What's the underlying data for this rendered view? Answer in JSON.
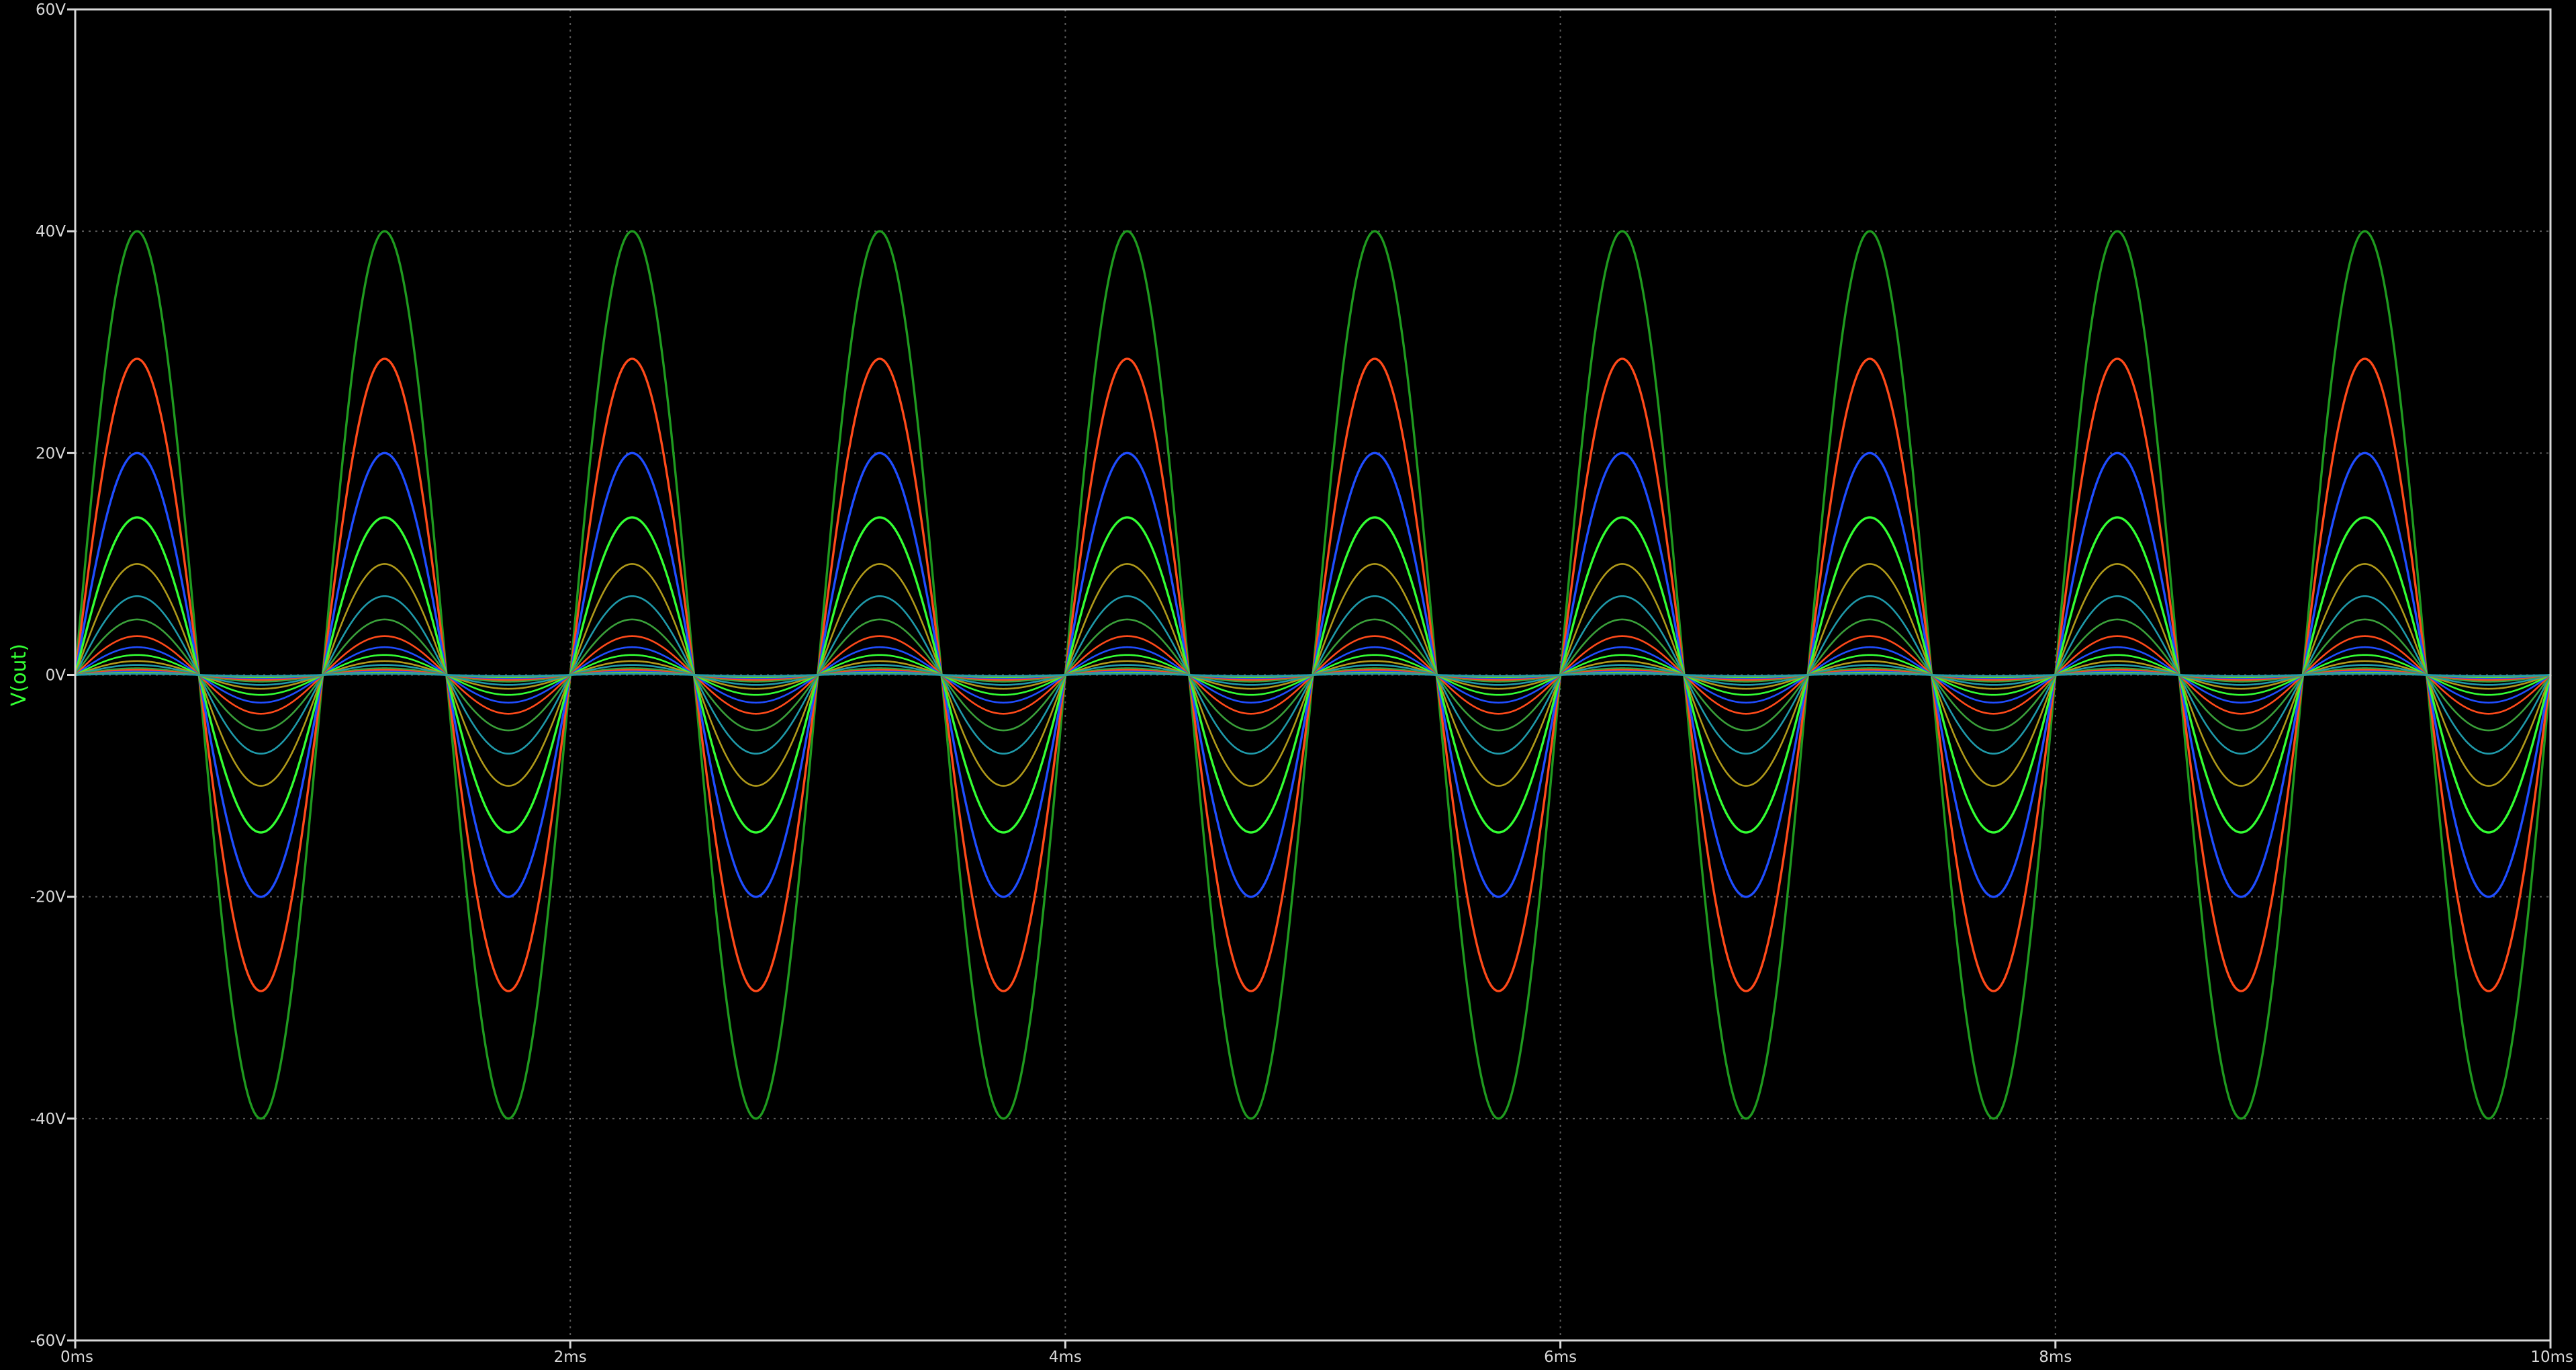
{
  "chart_data": {
    "type": "line",
    "title": "",
    "xlabel": "",
    "ylabel": "V(out)",
    "xlim": [
      0,
      10
    ],
    "ylim": [
      -60,
      60
    ],
    "x_unit": "ms",
    "y_unit": "V",
    "x_ticks": [
      "0ms",
      "2ms",
      "4ms",
      "6ms",
      "8ms",
      "10ms"
    ],
    "x_tick_values": [
      0,
      2,
      4,
      6,
      8,
      10
    ],
    "y_ticks": [
      "60V",
      "40V",
      "20V",
      "0V",
      "-20V",
      "-40V",
      "-60V"
    ],
    "y_tick_values": [
      60,
      40,
      20,
      0,
      -20,
      -40,
      -60
    ],
    "grid": true,
    "legend": "none",
    "waveform": "sine",
    "frequency_hz": 1000,
    "series": [
      {
        "amplitude": 40,
        "color": "#1f9a1f"
      },
      {
        "amplitude": 28.5,
        "color": "#ff4a1a"
      },
      {
        "amplitude": 20,
        "color": "#1f4dff"
      },
      {
        "amplitude": 14.2,
        "color": "#33ff33"
      },
      {
        "amplitude": 10,
        "color": "#b09a1a"
      },
      {
        "amplitude": 7.1,
        "color": "#1f9aaa"
      },
      {
        "amplitude": 5,
        "color": "#3aa03a"
      },
      {
        "amplitude": 3.5,
        "color": "#ff4a1a"
      },
      {
        "amplitude": 2.5,
        "color": "#1f4dff"
      },
      {
        "amplitude": 1.8,
        "color": "#33ff33"
      },
      {
        "amplitude": 1.25,
        "color": "#b09a1a"
      },
      {
        "amplitude": 0.9,
        "color": "#1f9aaa"
      },
      {
        "amplitude": 0.6,
        "color": "#3aa03a"
      },
      {
        "amplitude": 0.45,
        "color": "#ff4a1a"
      },
      {
        "amplitude": 0.3,
        "color": "#1f4dff"
      },
      {
        "amplitude": 0.2,
        "color": "#33ff33"
      },
      {
        "amplitude": 0.15,
        "color": "#b09a1a"
      },
      {
        "amplitude": 0.1,
        "color": "#1f9aaa"
      }
    ]
  },
  "colors": {
    "background": "#000000",
    "axis_frame": "#d8d8d8",
    "grid": "#5a5a5a",
    "tick_text": "#d8d8d8",
    "ylabel": "#33ff33"
  }
}
